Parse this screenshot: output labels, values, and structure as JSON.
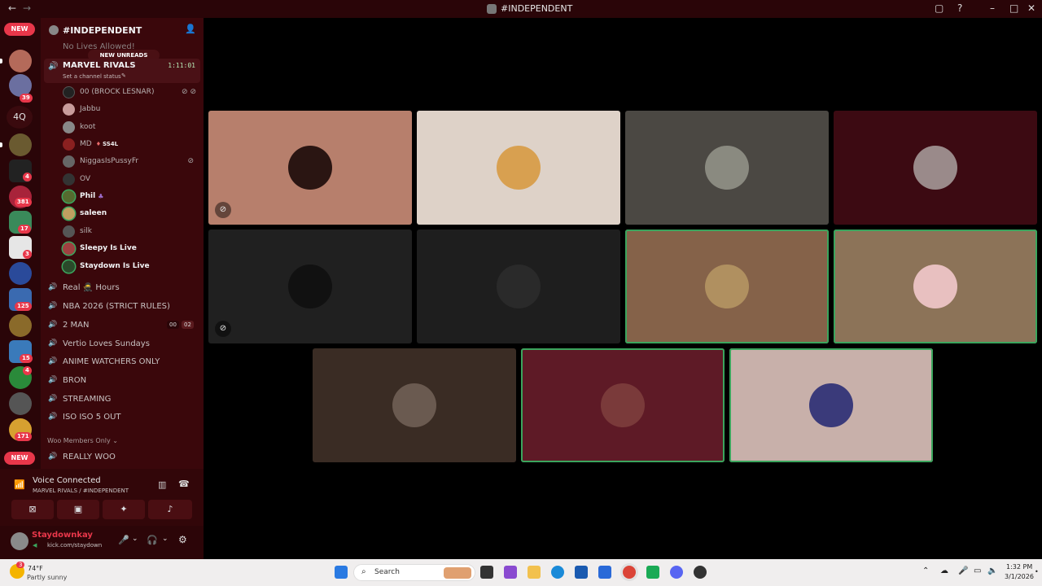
{
  "window": {
    "title": "#INDEPENDENT",
    "back_icon": "arrow-left-icon",
    "forward_icon": "arrow-right-icon"
  },
  "guilds": {
    "items": [
      {
        "name": "server-1",
        "color": "#8a2d2d",
        "badge": "NEW",
        "badge_type": "pill"
      },
      {
        "name": "server-2",
        "color": "#b46a5a",
        "badge": ""
      },
      {
        "name": "server-3",
        "color": "#6b6fa0",
        "badge": "39"
      },
      {
        "name": "server-4q",
        "text": "4Q",
        "color": "#3a0a0e",
        "badge": ""
      },
      {
        "name": "server-5",
        "color": "#6a5a30",
        "badge": ""
      },
      {
        "name": "server-6",
        "color": "#222",
        "badge": "4"
      },
      {
        "name": "server-7",
        "color": "#a8233a",
        "badge": "381"
      },
      {
        "name": "server-8",
        "color": "#3a8a5a",
        "badge": "17"
      },
      {
        "name": "server-9",
        "color": "#e6e6e6",
        "badge": "3"
      },
      {
        "name": "server-10",
        "color": "#2a4a9a",
        "badge": ""
      },
      {
        "name": "server-11",
        "color": "#3a6ab0",
        "badge": "125"
      },
      {
        "name": "server-12",
        "color": "#8a6a2a",
        "badge": ""
      },
      {
        "name": "server-13",
        "color": "#3a7aba",
        "badge": "15"
      },
      {
        "name": "server-14",
        "color": "#2a8a3a",
        "badge": "4"
      },
      {
        "name": "server-15",
        "color": "#555",
        "badge": ""
      },
      {
        "name": "server-16",
        "color": "#d6a030",
        "badge": "171"
      },
      {
        "name": "server-17",
        "color": "#8a2d2d",
        "badge": "NEW",
        "badge_type": "pill"
      }
    ]
  },
  "sidebar": {
    "server_name": "#INDEPENDENT",
    "add_member_icon": "person-add-icon",
    "partial_channel": "No Lives Allowed!",
    "new_unreads": "NEW UNREADS",
    "active_channel": {
      "name": "MARVEL RIVALS",
      "timer": "1:11:01",
      "status_prompt": "Set a channel status"
    },
    "voice_users": [
      {
        "name": "00 (BROCK LESNAR)",
        "color": "#222",
        "icons": "muted,deafened",
        "bold": false
      },
      {
        "name": "Jabbu",
        "color": "#c99b9b",
        "icons": "",
        "bold": false
      },
      {
        "name": "koot",
        "color": "#888",
        "icons": "",
        "bold": false
      },
      {
        "name": "MD",
        "tag": "SS4L",
        "color": "#8a2020",
        "icons": "",
        "bold": false
      },
      {
        "name": "NiggasIsPussyFr",
        "color": "#666",
        "icons": "muted",
        "bold": false
      },
      {
        "name": "OV",
        "color": "#333",
        "icons": "",
        "bold": false
      },
      {
        "name": "Phil",
        "color": "#556b2f",
        "icons": "",
        "bold": true
      },
      {
        "name": "saleen",
        "color": "#c0a060",
        "icons": "",
        "bold": true
      },
      {
        "name": "silk",
        "color": "#555",
        "icons": "",
        "bold": false
      },
      {
        "name": "Sleepy Is Live",
        "color": "#a04040",
        "icons": "",
        "bold": true
      },
      {
        "name": "Staydown Is Live",
        "color": "#2a4a2a",
        "icons": "",
        "bold": true
      }
    ],
    "channels": [
      {
        "name": "Real 🥷 Hours",
        "extra": ""
      },
      {
        "name": "NBA 2026 (STRICT RULES)",
        "extra": ""
      },
      {
        "name": "2 MAN",
        "extra_a": "00",
        "extra_b": "02"
      },
      {
        "name": "Vertio Loves Sundays",
        "extra": ""
      },
      {
        "name": "ANIME WATCHERS ONLY",
        "extra": ""
      },
      {
        "name": "BRON",
        "extra": ""
      },
      {
        "name": "STREAMING",
        "extra": ""
      },
      {
        "name": "ISO ISO 5 OUT",
        "extra": ""
      }
    ],
    "category": "Woo Members Only",
    "category_channel": "REALLY WOO"
  },
  "rtc": {
    "status": "Voice Connected",
    "location": "MARVEL RIVALS / #INDEPENDENT"
  },
  "user": {
    "name": "Staydownkay",
    "subtitle": "kick.com/staydown"
  },
  "tiles": [
    {
      "bg": "#b77f6c",
      "avatar": "#2a1512",
      "muted": true,
      "speaking": false
    },
    {
      "bg": "#ded2c8",
      "avatar": "#d8a050",
      "muted": false,
      "speaking": false
    },
    {
      "bg": "#4b4843",
      "avatar": "#8a8a80",
      "muted": false,
      "speaking": false
    },
    {
      "bg": "#3c0a12",
      "avatar": "#9a8a8a",
      "muted": false,
      "speaking": false
    },
    {
      "bg": "#202020",
      "avatar": "#111",
      "muted": true,
      "speaking": false
    },
    {
      "bg": "#1e1e1e",
      "avatar": "#2a2a2a",
      "muted": false,
      "speaking": false
    },
    {
      "bg": "#856249",
      "avatar": "#b09060",
      "muted": false,
      "speaking": true
    },
    {
      "bg": "#8c7358",
      "avatar": "#e8c0c0",
      "muted": false,
      "speaking": true
    },
    {
      "bg": "#3a2c24",
      "avatar": "#6a5a50",
      "muted": false,
      "speaking": false
    },
    {
      "bg": "#5e1a26",
      "avatar": "#7a3a3a",
      "muted": false,
      "speaking": true
    },
    {
      "bg": "#c8b0aa",
      "avatar": "#3a3a7a",
      "muted": false,
      "speaking": true
    }
  ],
  "taskbar": {
    "weather_temp": "74°F",
    "weather_desc": "Partly sunny",
    "weather_badge": "3",
    "search": "Search",
    "time": "1:32 PM",
    "date": "3/1/2026"
  }
}
